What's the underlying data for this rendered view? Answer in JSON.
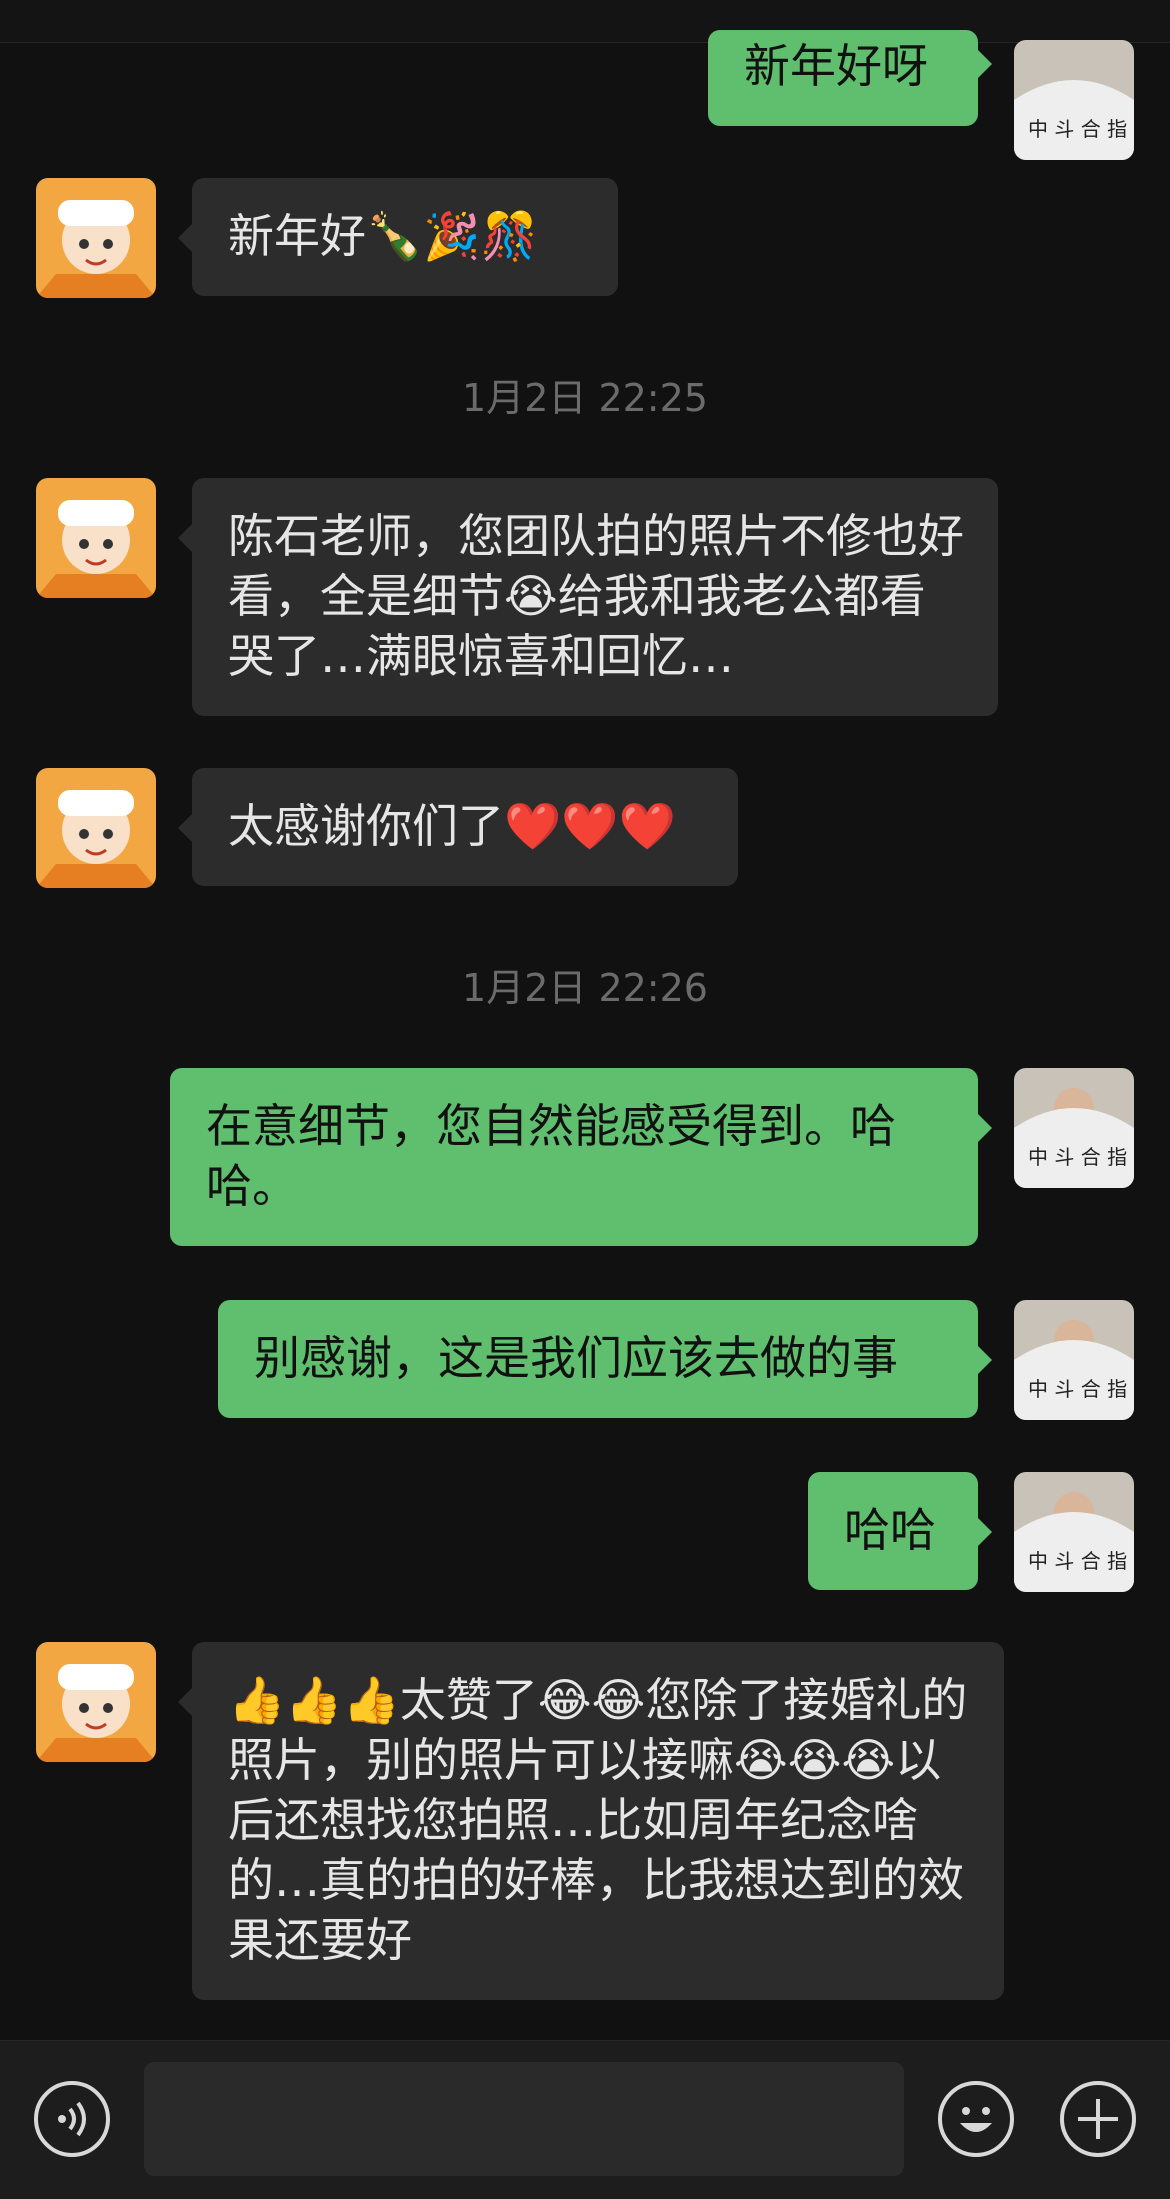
{
  "timestamps": [
    "1月2日 22:25",
    "1月2日 22:26"
  ],
  "messages": [
    {
      "side": "out",
      "text": "新年好呀"
    },
    {
      "side": "in",
      "text": "新年好🍾🎉🎊"
    },
    {
      "side": "in",
      "text": "陈石老师，您团队拍的照片不修也好看，全是细节😭给我和我老公都看哭了…满眼惊喜和回忆…"
    },
    {
      "side": "in",
      "text": "太感谢你们了❤️❤️❤️"
    },
    {
      "side": "out",
      "text": "在意细节，您自然能感受得到。哈哈。"
    },
    {
      "side": "out",
      "text": "别感谢，这是我们应该去做的事"
    },
    {
      "side": "out",
      "text": "哈哈"
    },
    {
      "side": "in",
      "text": "👍👍👍太赞了😂😂您除了接婚礼的照片，别的照片可以接嘛😭😭😭以后还想找您拍照…比如周年纪念啥的…真的拍的好棒，比我想达到的效果还要好"
    }
  ],
  "input": {
    "voice_icon": "voice-icon",
    "emoji_icon": "emoji-icon",
    "plus_icon": "plus-icon"
  },
  "colors": {
    "background": "#111111",
    "incoming_bubble": "#2c2c2c",
    "outgoing_bubble": "#5fbf6f"
  }
}
